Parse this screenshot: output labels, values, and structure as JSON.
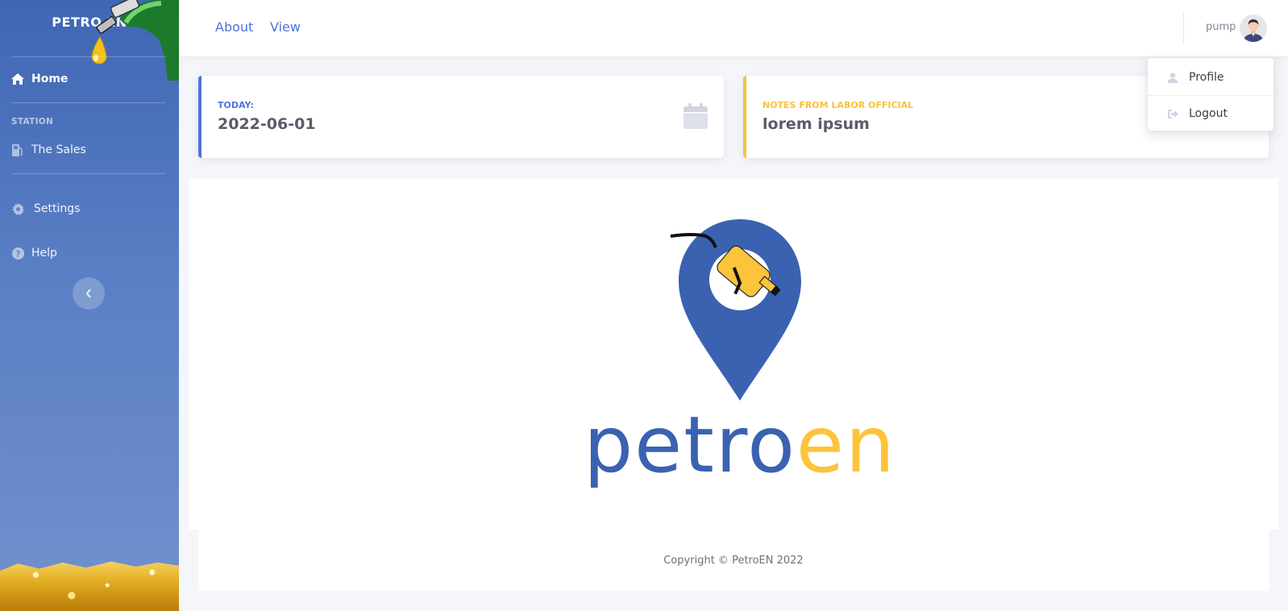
{
  "sidebar": {
    "brand": "PETRO EN",
    "nav": {
      "home": "Home",
      "heading": "STATION",
      "sales": "The Sales",
      "settings": "Settings",
      "help": "Help"
    }
  },
  "topbar": {
    "links": [
      "About",
      "View"
    ],
    "user_name": "pump"
  },
  "dropdown": {
    "items": [
      "Profile",
      "Logout"
    ]
  },
  "cards": [
    {
      "label": "TODAY:",
      "value": "2022-06-01",
      "accent": "#4e73df"
    },
    {
      "label": "NOTES FROM LABOR OFFICIAL",
      "value": "lorem ipsum",
      "accent": "#f6c23e"
    }
  ],
  "logo": {
    "word_part1": "petro",
    "word_part2": "en",
    "blue": "#3a62b0",
    "yellow": "#fcc43b"
  },
  "footer": {
    "copyright": "Copyright © PetroEN 2022"
  },
  "icons": {
    "home": "home-icon",
    "sales": "gas-pump-icon",
    "settings": "gear-icon",
    "help": "question-circle-icon",
    "toggle": "chevron-left-icon",
    "calendar": "calendar-icon",
    "profile": "user-icon",
    "logout": "sign-out-icon"
  }
}
